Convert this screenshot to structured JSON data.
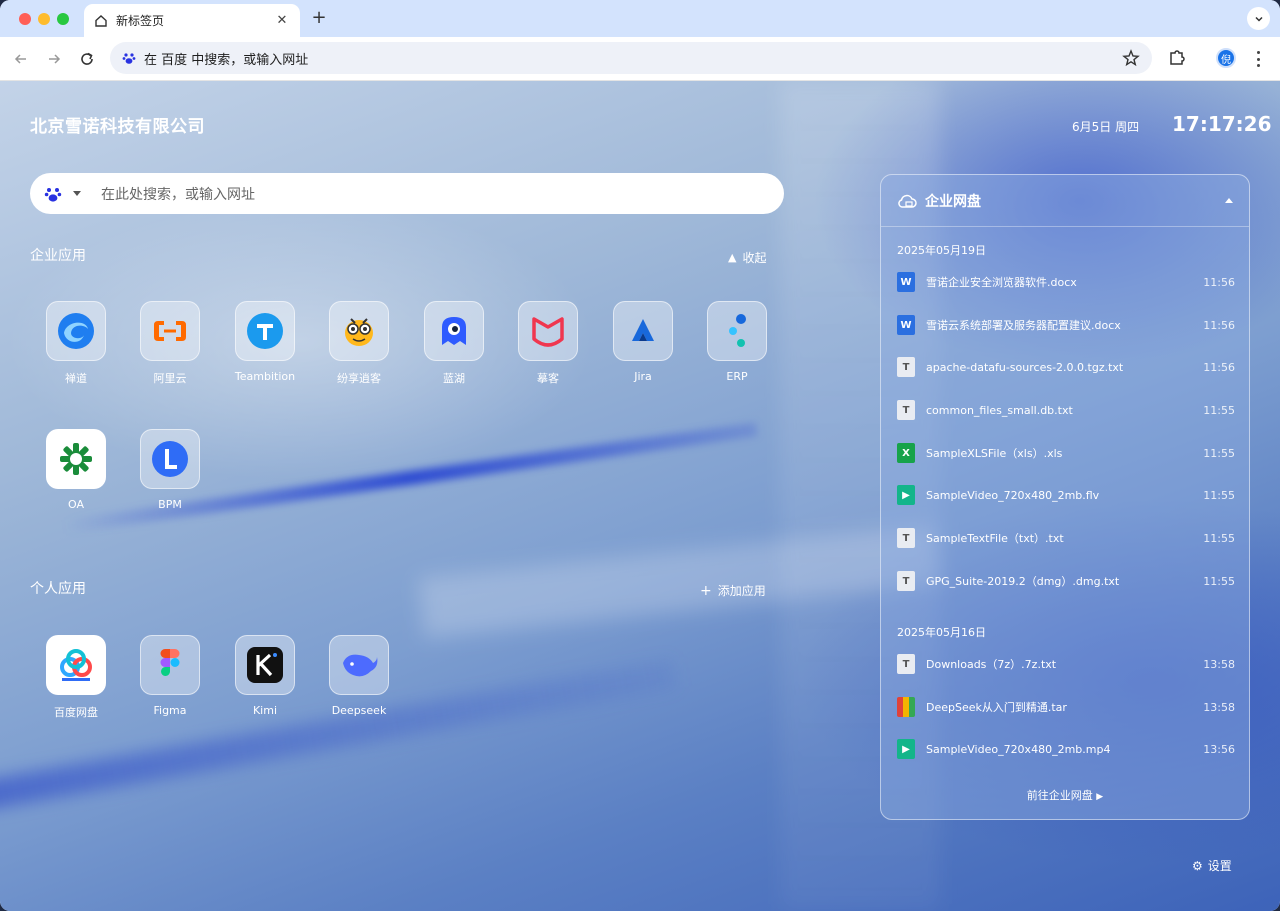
{
  "browser": {
    "tab_title": "新标签页",
    "omnibox_text": "在 百度 中搜索，或输入网址",
    "profile_initial": "倪"
  },
  "page": {
    "company": "北京雪诺科技有限公司",
    "date": "6月5日 周四",
    "time": "17:17:26",
    "search_placeholder": "在此处搜索，或输入网址",
    "enterprise_section": {
      "title": "企业应用",
      "action": "收起"
    },
    "personal_section": {
      "title": "个人应用",
      "action": "添加应用"
    },
    "enterprise_apps": [
      {
        "label": "禅道",
        "icon": "zentao-icon"
      },
      {
        "label": "阿里云",
        "icon": "aliyun-icon"
      },
      {
        "label": "Teambition",
        "icon": "teambition-icon"
      },
      {
        "label": "纷享逍客",
        "icon": "fxiaoke-icon"
      },
      {
        "label": "蓝湖",
        "icon": "lanhu-icon"
      },
      {
        "label": "摹客",
        "icon": "mockplus-icon"
      },
      {
        "label": "Jira",
        "icon": "jira-icon"
      },
      {
        "label": "ERP",
        "icon": "erp-icon"
      },
      {
        "label": "OA",
        "icon": "oa-icon"
      },
      {
        "label": "BPM",
        "icon": "bpm-icon"
      }
    ],
    "personal_apps": [
      {
        "label": "百度网盘",
        "icon": "baidu-netdisk-icon"
      },
      {
        "label": "Figma",
        "icon": "figma-icon"
      },
      {
        "label": "Kimi",
        "icon": "kimi-icon"
      },
      {
        "label": "Deepseek",
        "icon": "deepseek-icon"
      }
    ],
    "settings_label": "设置"
  },
  "drive": {
    "title": "企业网盘",
    "groups": [
      {
        "date": "2025年05月19日",
        "files": [
          {
            "name": "雪诺企业安全浏览器软件.docx",
            "time": "11:56",
            "type": "word"
          },
          {
            "name": "雪诺云系统部署及服务器配置建议.docx",
            "time": "11:56",
            "type": "word"
          },
          {
            "name": "apache-datafu-sources-2.0.0.tgz.txt",
            "time": "11:56",
            "type": "txt"
          },
          {
            "name": "common_files_small.db.txt",
            "time": "11:55",
            "type": "txt"
          },
          {
            "name": "SampleXLSFile（xls）.xls",
            "time": "11:55",
            "type": "xls"
          },
          {
            "name": "SampleVideo_720x480_2mb.flv",
            "time": "11:55",
            "type": "video"
          },
          {
            "name": "SampleTextFile（txt）.txt",
            "time": "11:55",
            "type": "txt"
          },
          {
            "name": "GPG_Suite-2019.2（dmg）.dmg.txt",
            "time": "11:55",
            "type": "txt"
          }
        ]
      },
      {
        "date": "2025年05月16日",
        "files": [
          {
            "name": "Downloads（7z）.7z.txt",
            "time": "13:58",
            "type": "txt"
          },
          {
            "name": "DeepSeek从入门到精通.tar",
            "time": "13:58",
            "type": "tar"
          },
          {
            "name": "SampleVideo_720x480_2mb.mp4",
            "time": "13:56",
            "type": "video"
          }
        ]
      }
    ],
    "footer": "前往企业网盘"
  },
  "colors": {
    "accent": "#1a73e8",
    "word": "#2b6fe0",
    "excel": "#17a34a",
    "video": "#13b58a"
  }
}
